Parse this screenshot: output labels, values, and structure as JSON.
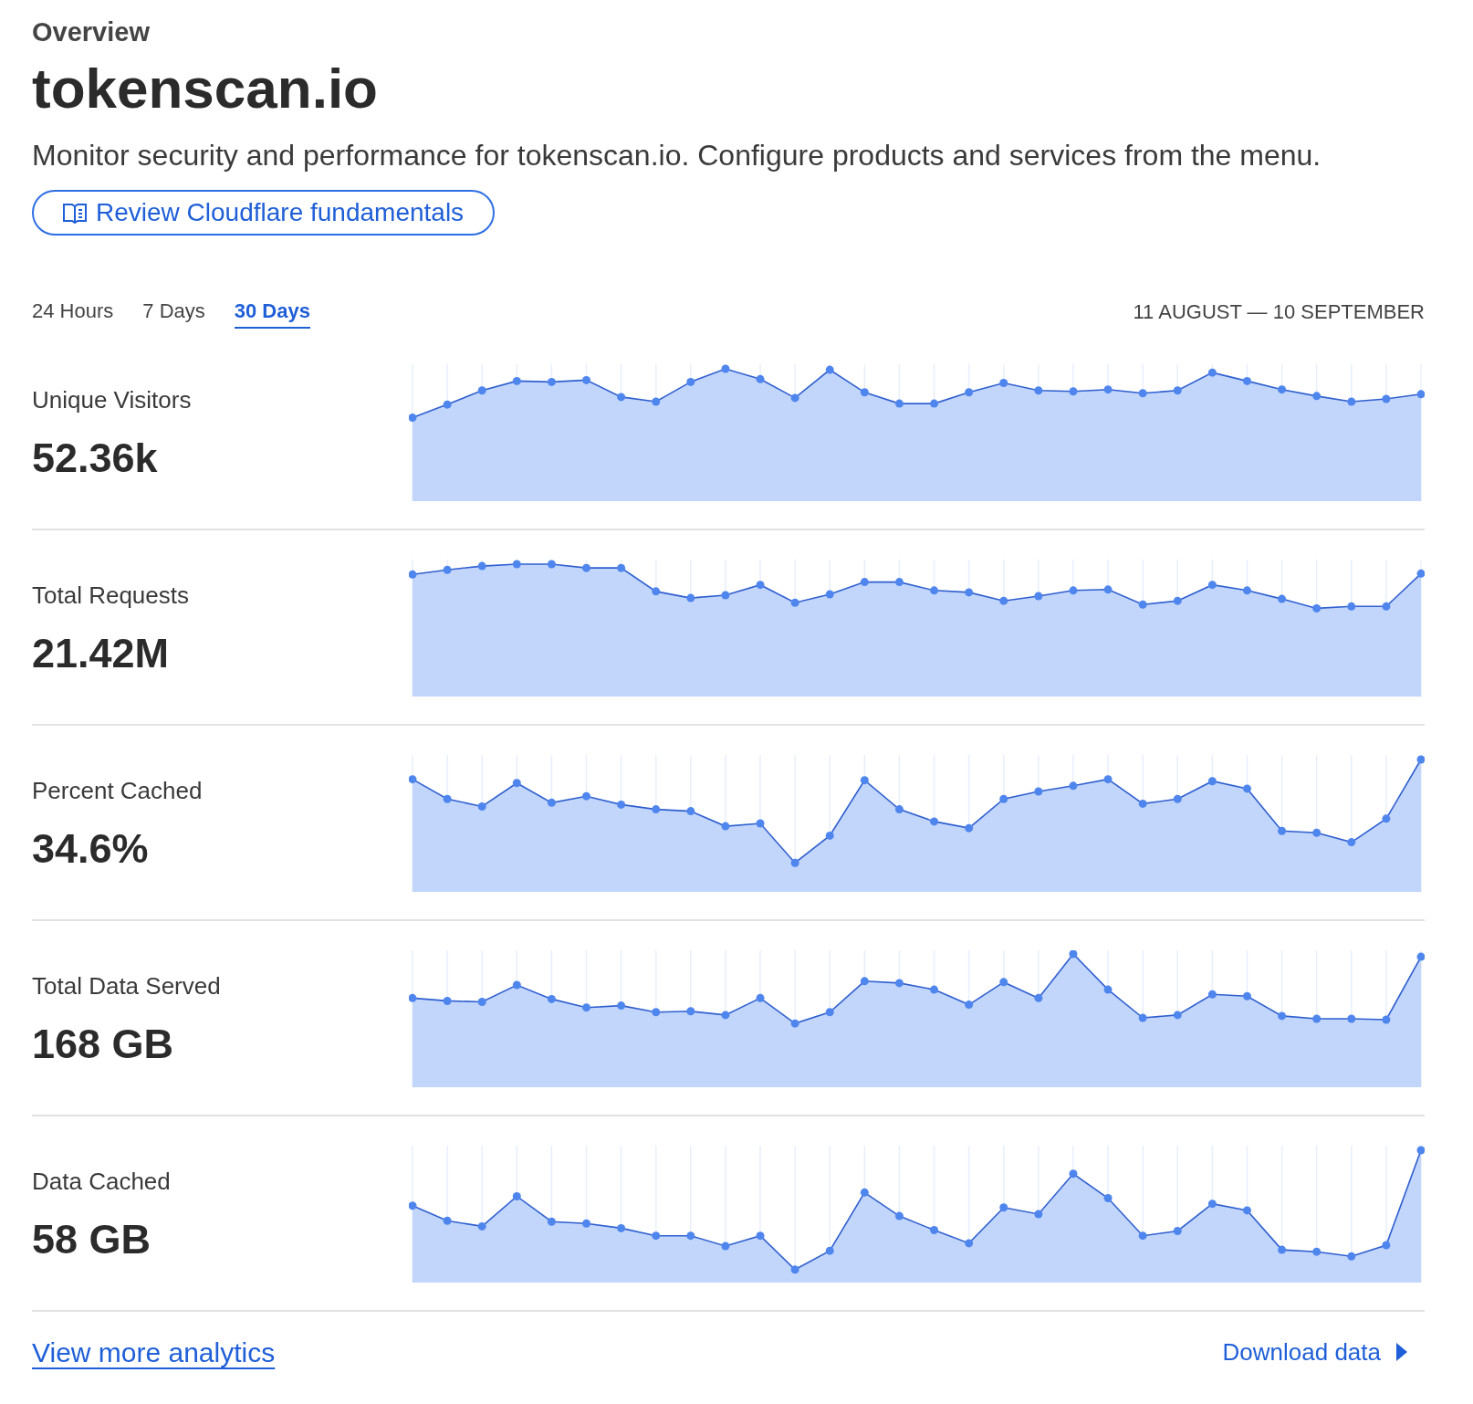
{
  "header": {
    "section": "Overview",
    "title": "tokenscan.io",
    "description": "Monitor security and performance for tokenscan.io. Configure products and services from the menu.",
    "guide_button": "Review Cloudflare fundamentals"
  },
  "tabs": [
    {
      "label": "24 Hours",
      "selected": false
    },
    {
      "label": "7 Days",
      "selected": false
    },
    {
      "label": "30 Days",
      "selected": true
    }
  ],
  "date_range": "11 AUGUST — 10 SEPTEMBER",
  "metrics": [
    {
      "label": "Unique Visitors",
      "value": "52.36k"
    },
    {
      "label": "Total Requests",
      "value": "21.42M"
    },
    {
      "label": "Percent Cached",
      "value": "34.6%"
    },
    {
      "label": "Total Data Served",
      "value": "168 GB"
    },
    {
      "label": "Data Cached",
      "value": "58 GB"
    }
  ],
  "footer": {
    "analytics_link": "View more analytics",
    "download_link": "Download data"
  }
}
